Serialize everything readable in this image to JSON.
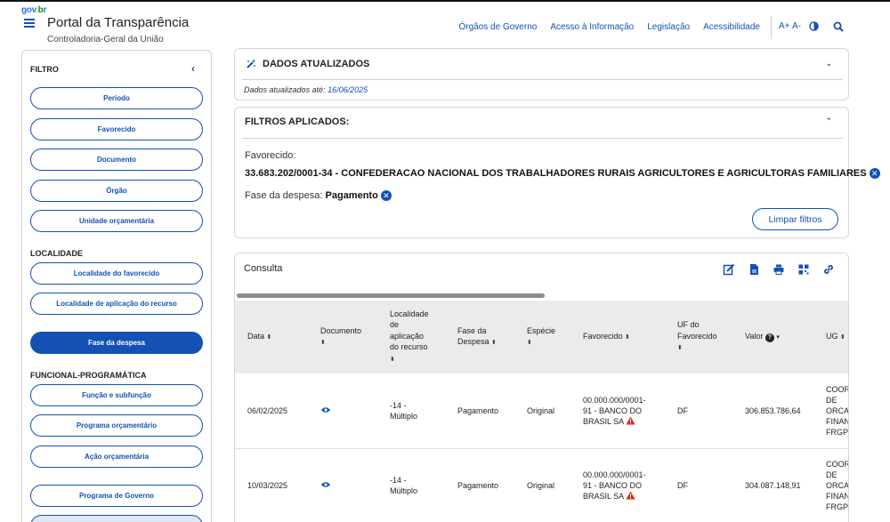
{
  "header": {
    "logo": [
      "gov",
      ".",
      "b",
      "r"
    ],
    "title": "Portal da Transparência",
    "subtitle": "Controladoria-Geral da União",
    "links": [
      "Órgãos de Governo",
      "Acesso à Informação",
      "Legislação",
      "Acessibilidade"
    ],
    "font_increase": "A+",
    "font_decrease": "A-"
  },
  "sidebar": {
    "filter_title": "FILTRO",
    "collapse": "‹",
    "filtro_buttons": [
      "Período",
      "Favorecido",
      "Documento",
      "Órgão",
      "Unidade orçamentária"
    ],
    "localidade_title": "LOCALIDADE",
    "localidade_buttons": [
      "Localidade do favorecido",
      "Localidade de aplicação do recurso"
    ],
    "active_button": "Fase da despesa",
    "funcional_title": "FUNCIONAL-PROGRAMÁTICA",
    "funcional_buttons": [
      "Função e subfunção",
      "Programa orçamentário",
      "Ação orçamentária"
    ],
    "programa_button": "Programa de Governo"
  },
  "dados": {
    "title": "DADOS ATUALIZADOS",
    "label": "Dados atualizados até:",
    "date": "16/06/2025"
  },
  "filtros": {
    "title": "FILTROS APLICADOS:",
    "favorecido_label": "Favorecido:",
    "favorecido_value": "33.683.202/0001-34 - CONFEDERACAO NACIONAL DOS TRABALHADORES RURAIS AGRICULTORES E AGRICULTORAS FAMILIARES",
    "fase_label": "Fase da despesa:",
    "fase_value": "Pagamento",
    "clear": "Limpar filtros"
  },
  "consulta": {
    "title": "Consulta",
    "columns": {
      "data": "Data",
      "documento": "Documento",
      "localidade": [
        "Localidade",
        "de",
        "aplicação",
        "do recurso"
      ],
      "fase": [
        "Fase da",
        "Despesa"
      ],
      "especie": "Espécie",
      "favorecido": "Favorecido",
      "uf": [
        "UF do",
        "Favorecido"
      ],
      "valor": "Valor",
      "ug": "UG"
    },
    "rows": [
      {
        "data": "06/02/2025",
        "localidade": [
          "-14 -",
          "Múltiplo"
        ],
        "fase": "Pagamento",
        "especie": "Original",
        "favorecido": [
          "00.000.000/0001-",
          "91 - BANCO DO",
          "BRASIL SA"
        ],
        "uf": "DF",
        "valor": "306.853.786,64",
        "ug": [
          "COORD",
          "DE",
          "ORCAM",
          "FINANC",
          "FRGPS"
        ]
      },
      {
        "data": "10/03/2025",
        "localidade": [
          "-14 -",
          "Múltiplo"
        ],
        "fase": "Pagamento",
        "especie": "Original",
        "favorecido": [
          "00.000.000/0001-",
          "91 - BANCO DO",
          "BRASIL SA"
        ],
        "uf": "DF",
        "valor": "304.087.148,91",
        "ug": [
          "COORD",
          "DE",
          "ORCAM",
          "FINANC",
          "FRGPS"
        ]
      }
    ]
  }
}
